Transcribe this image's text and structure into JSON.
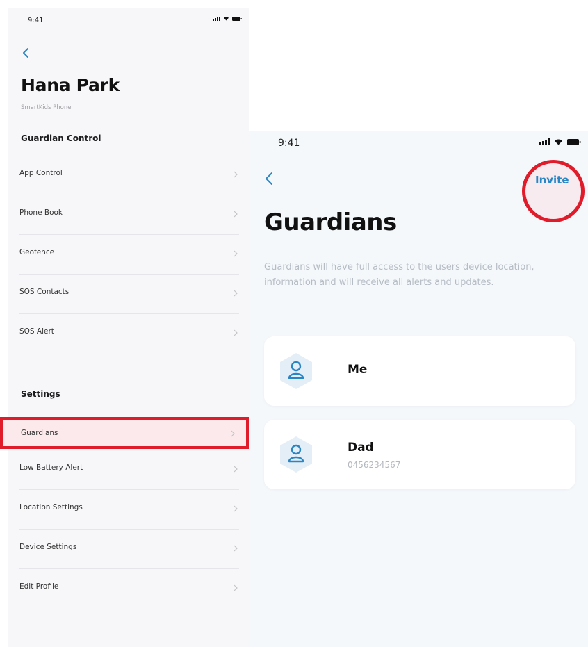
{
  "left_screen": {
    "status_time": "9:41",
    "title": "Hana Park",
    "subtitle": "SmartKids Phone",
    "sections": {
      "guardian_control": "Guardian Control",
      "settings": "Settings"
    },
    "guardian_items": [
      "App Control",
      "Phone Book",
      "Geofence",
      "SOS Contacts",
      "SOS Alert"
    ],
    "settings_items": [
      "Guardians",
      "Low Battery Alert",
      "Location Settings",
      "Device Settings",
      "Edit Profile"
    ]
  },
  "right_screen": {
    "status_time": "9:41",
    "invite_label": "Invite",
    "title": "Guardians",
    "description": "Guardians will have full access to the users device location, information and will receive all alerts and updates.",
    "guardians": [
      {
        "name": "Me",
        "phone": ""
      },
      {
        "name": "Dad",
        "phone": "0456234567"
      }
    ]
  },
  "colors": {
    "accent": "#2a85c4",
    "highlight": "#e01b2a",
    "avatar_bg": "#e4eef7"
  },
  "icons": {
    "back": "chevron-left-icon",
    "row_chevron": "chevron-right-icon",
    "avatar": "user-icon",
    "signal": "signal-icon",
    "wifi": "wifi-icon",
    "battery": "battery-icon"
  }
}
